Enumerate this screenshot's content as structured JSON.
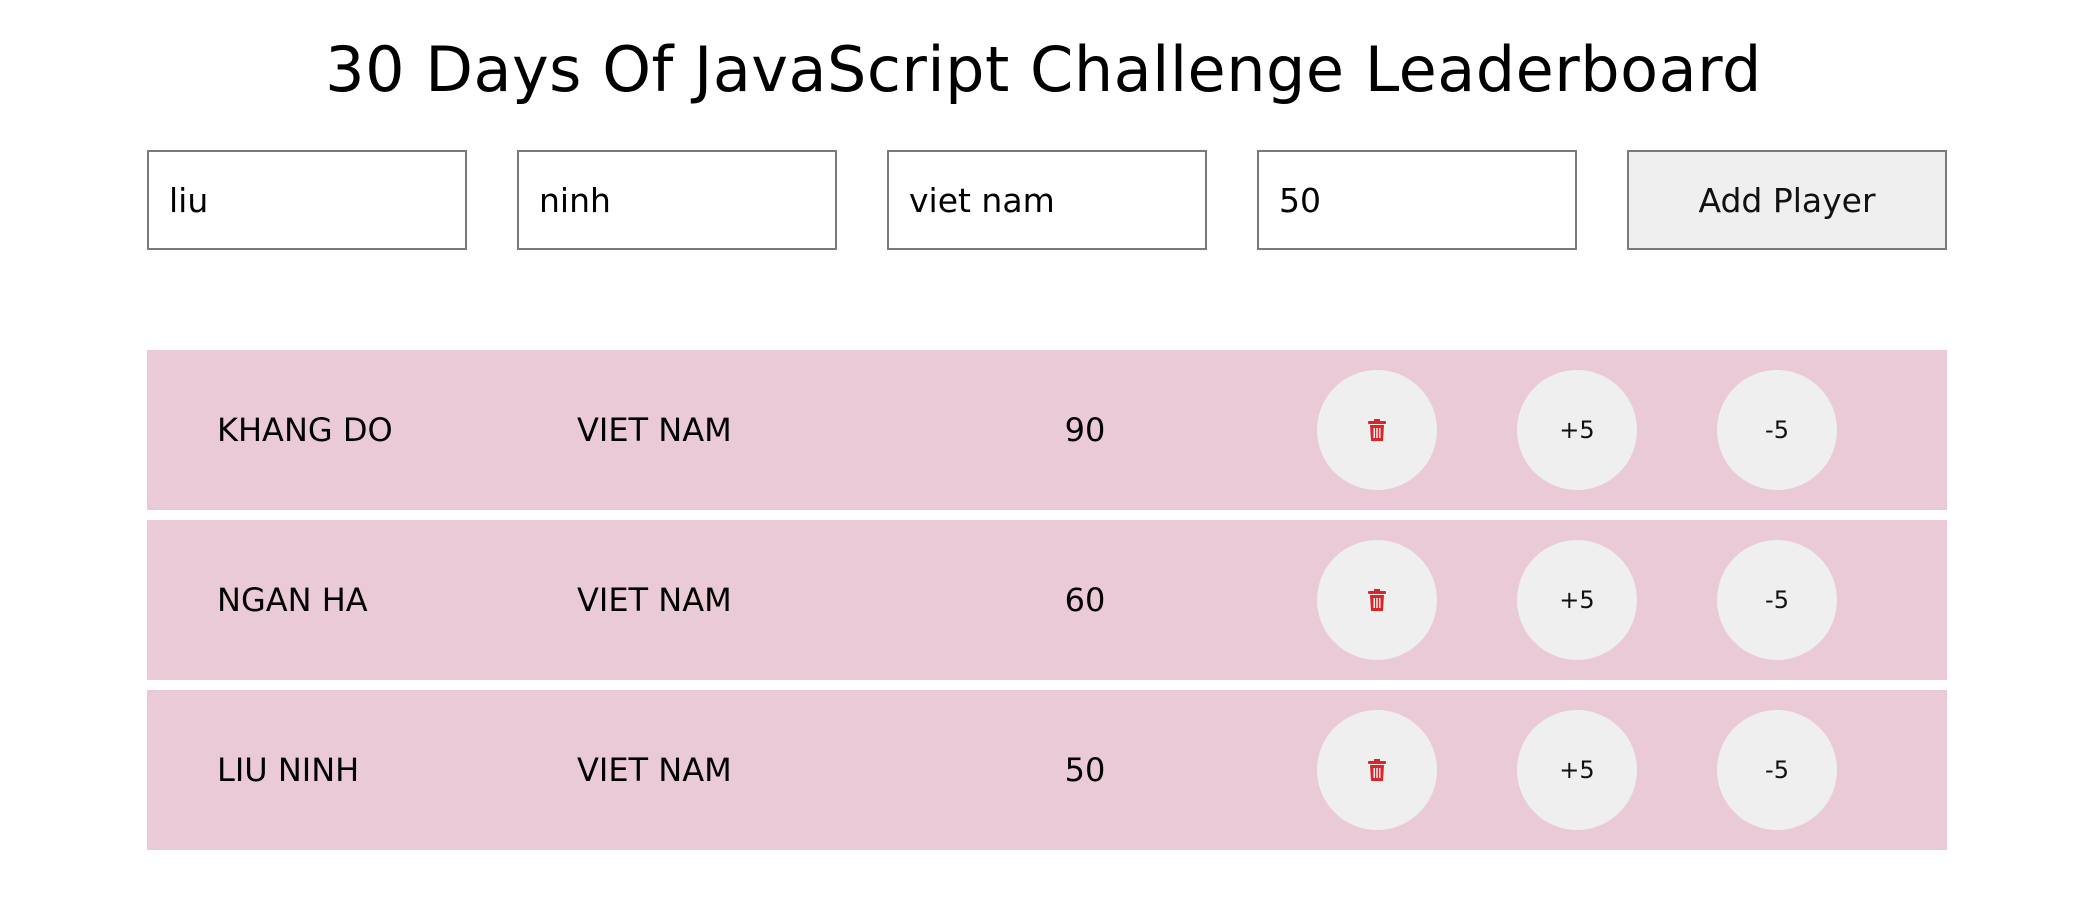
{
  "page": {
    "title": "30 Days Of JavaScript Challenge Leaderboard"
  },
  "form": {
    "first_name_value": "liu",
    "last_name_value": "ninh",
    "country_value": "viet nam",
    "score_value": "50",
    "add_button_label": "Add Player"
  },
  "players": [
    {
      "name": "KHANG DO",
      "country": "VIET NAM",
      "score": "90",
      "plus_label": "+5",
      "minus_label": "-5",
      "delete_icon": "trash-icon"
    },
    {
      "name": "NGAN HA",
      "country": "VIET NAM",
      "score": "60",
      "plus_label": "+5",
      "minus_label": "-5",
      "delete_icon": "trash-icon"
    },
    {
      "name": "LIU NINH",
      "country": "VIET NAM",
      "score": "50",
      "plus_label": "+5",
      "minus_label": "-5",
      "delete_icon": "trash-icon"
    }
  ],
  "colors": {
    "row_background": "#ebcad7",
    "circle_button_background": "#efefef",
    "delete_icon_color": "#d9262b"
  }
}
